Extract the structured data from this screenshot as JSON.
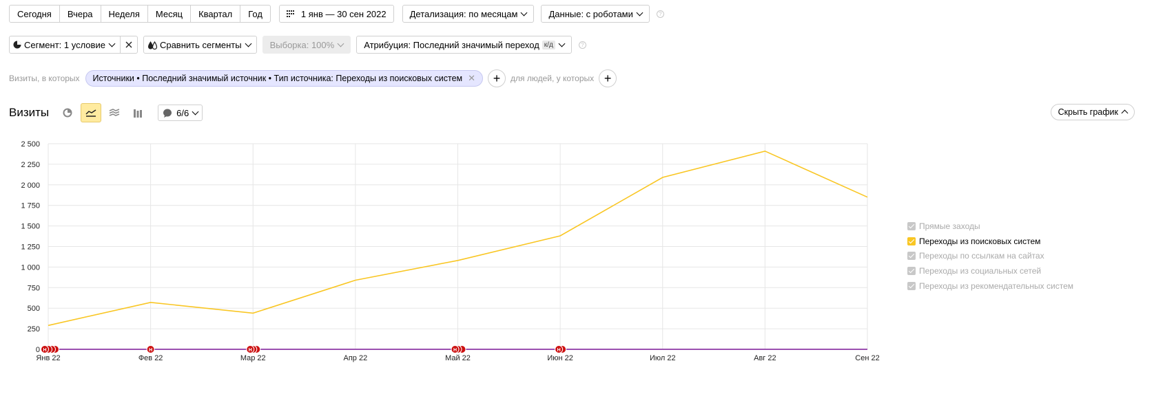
{
  "toolbar": {
    "periods": [
      "Сегодня",
      "Вчера",
      "Неделя",
      "Месяц",
      "Квартал",
      "Год"
    ],
    "date_range": "1 янв — 30 сен 2022",
    "detail": "Детализация: по месяцам",
    "data_mode": "Данные: с роботами",
    "help": "?"
  },
  "segment_bar": {
    "segment": "Сегмент: 1 условие",
    "compare": "Сравнить сегменты",
    "sample": "Выборка: 100%",
    "attribution": "Атрибуция: Последний значимый переход",
    "attribution_badge": "к/д"
  },
  "filter": {
    "visits_prefix": "Визиты, в которых",
    "chip": "Источники • Последний значимый источник • Тип источника: Переходы из поисковых систем",
    "people_prefix": "для людей, у которых"
  },
  "chart_header": {
    "title": "Визиты",
    "annotations_count": "6/6",
    "hide_chart": "Скрыть график"
  },
  "legend": [
    {
      "label": "Прямые заходы",
      "checked": false
    },
    {
      "label": "Переходы из поисковых систем",
      "checked": true
    },
    {
      "label": "Переходы по ссылкам на сайтах",
      "checked": false
    },
    {
      "label": "Переходы из социальных сетей",
      "checked": false
    },
    {
      "label": "Переходы из рекомендательных систем",
      "checked": false
    }
  ],
  "colors": {
    "series": "#f9c623",
    "baseline": "#9b4fb0",
    "marker": "#cc1010",
    "accent": "#ffeba0"
  },
  "chart_data": {
    "type": "line",
    "categories": [
      "Янв 22",
      "Фев 22",
      "Мар 22",
      "Апр 22",
      "Май 22",
      "Июн 22",
      "Июл 22",
      "Авг 22",
      "Сен 22"
    ],
    "series": [
      {
        "name": "Переходы из поисковых систем",
        "values": [
          290,
          570,
          440,
          840,
          1080,
          1380,
          2090,
          2410,
          1850
        ]
      }
    ],
    "y_ticks": [
      "0",
      "250",
      "500",
      "750",
      "1 000",
      "1 250",
      "1 500",
      "1 750",
      "2 000",
      "2 250",
      "2 500"
    ],
    "ylim": [
      0,
      2500
    ],
    "grid": true,
    "legend_position": "right",
    "annotation_marker": "Н",
    "annotation_months": [
      "Янв 22",
      "Фев 22",
      "Мар 22",
      "Май 22",
      "Июн 22"
    ]
  }
}
